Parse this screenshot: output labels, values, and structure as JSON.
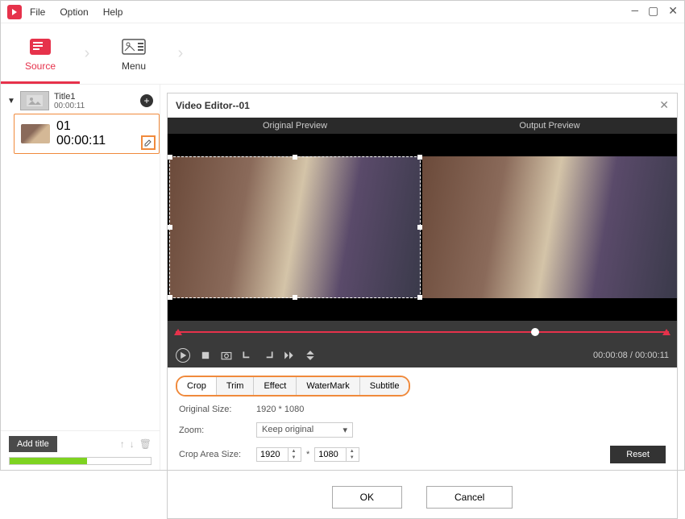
{
  "menubar": {
    "file": "File",
    "option": "Option",
    "help": "Help"
  },
  "steps": {
    "source": "Source",
    "menu": "Menu"
  },
  "tree": {
    "root": {
      "title": "Title1",
      "time": "00:00:11"
    },
    "clip": {
      "title": "01",
      "time": "00:00:11"
    }
  },
  "sidebar": {
    "add_title": "Add title"
  },
  "editor": {
    "title": "Video Editor--01",
    "original_preview": "Original Preview",
    "output_preview": "Output Preview",
    "time_current": "00:00:08",
    "time_total": "00:00:11",
    "tabs": {
      "crop": "Crop",
      "trim": "Trim",
      "effect": "Effect",
      "watermark": "WaterMark",
      "subtitle": "Subtitle"
    },
    "settings": {
      "original_size_label": "Original Size:",
      "original_size_value": "1920 * 1080",
      "zoom_label": "Zoom:",
      "zoom_value": "Keep original",
      "crop_area_label": "Crop Area Size:",
      "crop_w": "1920",
      "crop_h": "1080",
      "times": "*",
      "reset": "Reset"
    },
    "ok": "OK",
    "cancel": "Cancel"
  }
}
